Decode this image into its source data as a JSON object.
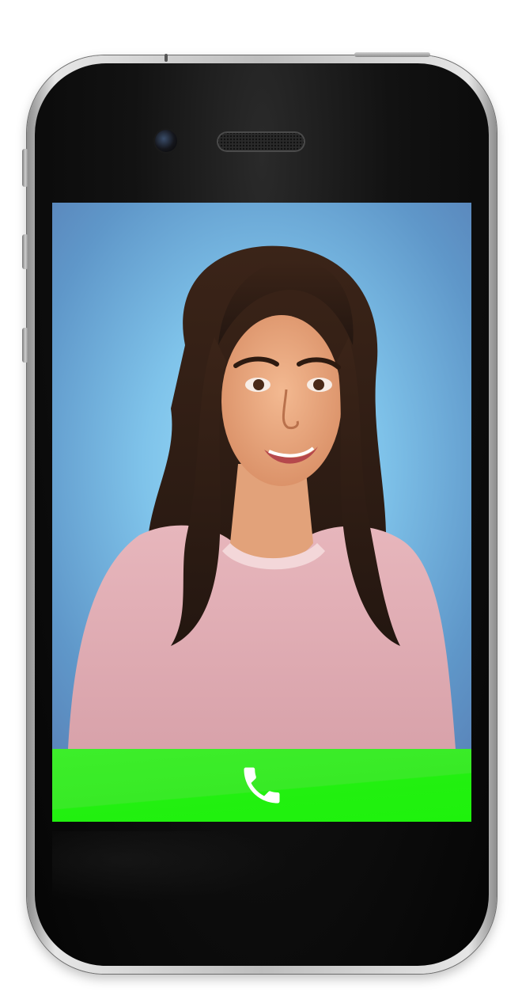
{
  "app": {
    "screen": "incoming-call"
  },
  "call": {
    "answer_icon": "phone-icon",
    "accent_color": "#2bef1a"
  },
  "device": {
    "frame_color": "#c9c9c9",
    "face_color": "#0b0b0b"
  },
  "avatar": {
    "icon": "caller-portrait"
  }
}
